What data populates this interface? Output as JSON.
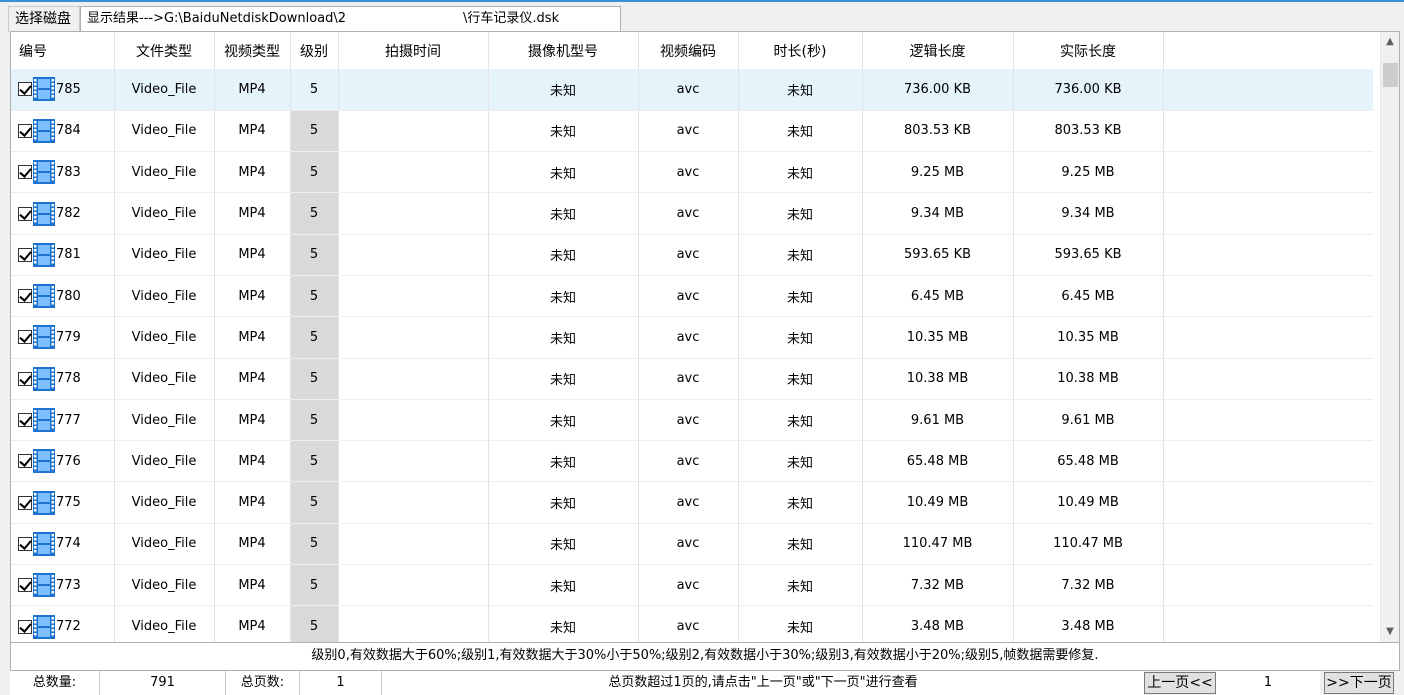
{
  "tabs": {
    "select_disk": "选择磁盘",
    "results": "显示结果--->G:\\BaiduNetdiskDownload\\2                  \\行车记录仪.dsk"
  },
  "columns": [
    "编号",
    "文件类型",
    "视频类型",
    "级别",
    "拍摄时间",
    "摄像机型号",
    "视频编码",
    "时长(秒)",
    "逻辑长度",
    "实际长度"
  ],
  "rows": [
    {
      "id": "785",
      "file_type": "Video_File",
      "video_type": "MP4",
      "level": "5",
      "time": "",
      "camera": "未知",
      "codec": "avc",
      "duration": "未知",
      "logical": "736.00 KB",
      "actual": "736.00 KB"
    },
    {
      "id": "784",
      "file_type": "Video_File",
      "video_type": "MP4",
      "level": "5",
      "time": "",
      "camera": "未知",
      "codec": "avc",
      "duration": "未知",
      "logical": "803.53 KB",
      "actual": "803.53 KB"
    },
    {
      "id": "783",
      "file_type": "Video_File",
      "video_type": "MP4",
      "level": "5",
      "time": "",
      "camera": "未知",
      "codec": "avc",
      "duration": "未知",
      "logical": "9.25 MB",
      "actual": "9.25 MB"
    },
    {
      "id": "782",
      "file_type": "Video_File",
      "video_type": "MP4",
      "level": "5",
      "time": "",
      "camera": "未知",
      "codec": "avc",
      "duration": "未知",
      "logical": "9.34 MB",
      "actual": "9.34 MB"
    },
    {
      "id": "781",
      "file_type": "Video_File",
      "video_type": "MP4",
      "level": "5",
      "time": "",
      "camera": "未知",
      "codec": "avc",
      "duration": "未知",
      "logical": "593.65 KB",
      "actual": "593.65 KB"
    },
    {
      "id": "780",
      "file_type": "Video_File",
      "video_type": "MP4",
      "level": "5",
      "time": "",
      "camera": "未知",
      "codec": "avc",
      "duration": "未知",
      "logical": "6.45 MB",
      "actual": "6.45 MB"
    },
    {
      "id": "779",
      "file_type": "Video_File",
      "video_type": "MP4",
      "level": "5",
      "time": "",
      "camera": "未知",
      "codec": "avc",
      "duration": "未知",
      "logical": "10.35 MB",
      "actual": "10.35 MB"
    },
    {
      "id": "778",
      "file_type": "Video_File",
      "video_type": "MP4",
      "level": "5",
      "time": "",
      "camera": "未知",
      "codec": "avc",
      "duration": "未知",
      "logical": "10.38 MB",
      "actual": "10.38 MB"
    },
    {
      "id": "777",
      "file_type": "Video_File",
      "video_type": "MP4",
      "level": "5",
      "time": "",
      "camera": "未知",
      "codec": "avc",
      "duration": "未知",
      "logical": "9.61 MB",
      "actual": "9.61 MB"
    },
    {
      "id": "776",
      "file_type": "Video_File",
      "video_type": "MP4",
      "level": "5",
      "time": "",
      "camera": "未知",
      "codec": "avc",
      "duration": "未知",
      "logical": "65.48 MB",
      "actual": "65.48 MB"
    },
    {
      "id": "775",
      "file_type": "Video_File",
      "video_type": "MP4",
      "level": "5",
      "time": "",
      "camera": "未知",
      "codec": "avc",
      "duration": "未知",
      "logical": "10.49 MB",
      "actual": "10.49 MB"
    },
    {
      "id": "774",
      "file_type": "Video_File",
      "video_type": "MP4",
      "level": "5",
      "time": "",
      "camera": "未知",
      "codec": "avc",
      "duration": "未知",
      "logical": "110.47 MB",
      "actual": "110.47 MB"
    },
    {
      "id": "773",
      "file_type": "Video_File",
      "video_type": "MP4",
      "level": "5",
      "time": "",
      "camera": "未知",
      "codec": "avc",
      "duration": "未知",
      "logical": "7.32 MB",
      "actual": "7.32 MB"
    },
    {
      "id": "772",
      "file_type": "Video_File",
      "video_type": "MP4",
      "level": "5",
      "time": "",
      "camera": "未知",
      "codec": "avc",
      "duration": "未知",
      "logical": "3.48 MB",
      "actual": "3.48 MB"
    }
  ],
  "level_note": "级别0,有效数据大于60%;级别1,有效数据大于30%小于50%;级别2,有效数据小于30%;级别3,有效数据小于20%;级别5,帧数据需要修复.",
  "status": {
    "total_label": "总数量:",
    "total_value": "791",
    "pages_label": "总页数:",
    "pages_value": "1",
    "hint": "总页数超过1页的,请点击\"上一页\"或\"下一页\"进行查看",
    "prev_button": "上一页<<",
    "current_page": "1",
    "next_button": ">>下一页"
  },
  "colors": {
    "selected_row": "#e5f3fb",
    "level_cell": "#d9d9d9",
    "accent": "#3c8fd6",
    "film_icon": "#1e73d2"
  },
  "icons": {
    "checkbox": "checked-checkbox-icon",
    "video": "film-strip-icon",
    "scroll_up": "chevron-up-icon",
    "scroll_down": "chevron-down-icon"
  }
}
